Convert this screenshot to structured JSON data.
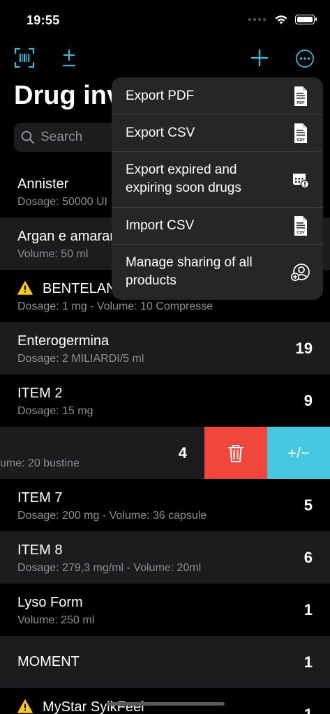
{
  "status": {
    "time": "19:55"
  },
  "header": {
    "title": "Drug inventory"
  },
  "search": {
    "placeholder": "Search"
  },
  "rows": [
    {
      "title": "Annister",
      "subtitle": "Dosage: 50000 UI",
      "count": "",
      "warning": false
    },
    {
      "title": "Argan e amaranto",
      "subtitle": "Volume: 50 ml",
      "count": "",
      "warning": false
    },
    {
      "title": "BENTELAN",
      "subtitle": "Dosage: 1 mg - Volume: 10 Compresse",
      "count": "",
      "warning": true
    },
    {
      "title": "Enterogermina",
      "subtitle": "Dosage: 2 MILIARDI/5 ml",
      "count": "19",
      "warning": false
    },
    {
      "title": "ITEM 2",
      "subtitle": "Dosage: 15 mg",
      "count": "9",
      "warning": false
    },
    {
      "title": "",
      "subtitle": "ume: 20 bustine",
      "count": "4",
      "warning": false
    },
    {
      "title": "ITEM 7",
      "subtitle": "Dosage: 200 mg - Volume: 36 capsule",
      "count": "5",
      "warning": false
    },
    {
      "title": "ITEM 8",
      "subtitle": "Dosage: 279,3 mg/ml - Volume: 20ml",
      "count": "6",
      "warning": false
    },
    {
      "title": "Lyso Form",
      "subtitle": "Volume: 250 ml",
      "count": "1",
      "warning": false
    },
    {
      "title": "MOMENT",
      "subtitle": "",
      "count": "1",
      "warning": false
    },
    {
      "title": "MyStar SylkFeel",
      "subtitle": "",
      "count": "1",
      "warning": true
    }
  ],
  "swipe": {
    "adjust_label": "+/−"
  },
  "menu": {
    "items": [
      {
        "label": "Export PDF",
        "icon": "pdf-file-icon"
      },
      {
        "label": "Export CSV",
        "icon": "csv-file-icon"
      },
      {
        "label": "Export expired and expiring soon drugs",
        "icon": "calendar-alert-icon"
      },
      {
        "label": "Import CSV",
        "icon": "csv-file-icon"
      },
      {
        "label": "Manage sharing of all products",
        "icon": "person-add-icon"
      }
    ]
  },
  "colors": {
    "accent": "#3fb6d8",
    "delete": "#f1463c",
    "adjust": "#45c7e0",
    "warning": "#f6c915"
  }
}
